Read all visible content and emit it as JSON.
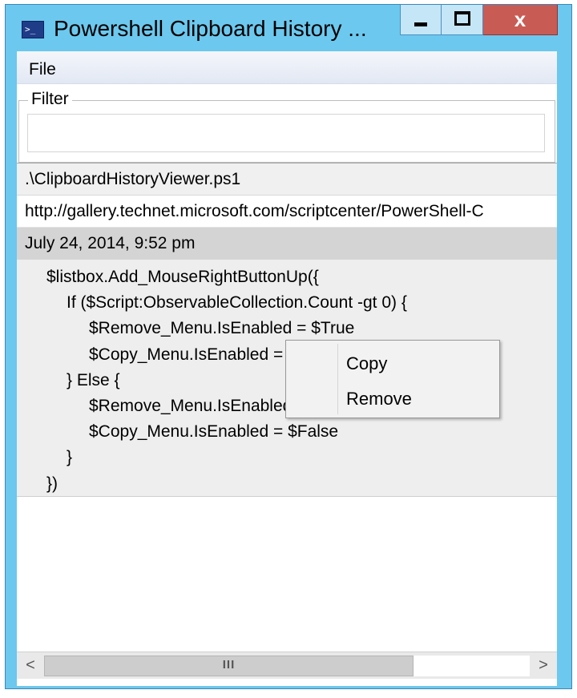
{
  "window": {
    "title": "Powershell Clipboard History ...",
    "icon": "powershell-icon",
    "controls": {
      "minimize": "minimize-icon",
      "maximize": "maximize-icon",
      "close_glyph": "x"
    }
  },
  "menubar": {
    "items": [
      {
        "label": "File"
      }
    ]
  },
  "filter": {
    "legend": "Filter",
    "value": "",
    "placeholder": ""
  },
  "history": {
    "items": [
      {
        "text": ".\\ClipboardHistoryViewer.ps1"
      },
      {
        "text": "http://gallery.technet.microsoft.com/scriptcenter/PowerShell-C"
      },
      {
        "text": "July 24, 2014, 9:52 pm"
      }
    ],
    "selected_code": [
      "$listbox.Add_MouseRightButtonUp({",
      "If ($Script:ObservableCollection.Count -gt 0) {",
      "$Remove_Menu.IsEnabled = $True",
      "$Copy_Menu.IsEnabled = $True",
      "} Else {",
      "$Remove_Menu.IsEnabled = $False",
      "$Copy_Menu.IsEnabled = $False",
      "}",
      "})"
    ]
  },
  "context_menu": {
    "items": [
      {
        "label": "Copy"
      },
      {
        "label": "Remove"
      }
    ]
  },
  "scrollbar": {
    "left_arrow": "<",
    "right_arrow": ">",
    "grip": "III",
    "thumb_fraction": 0.76
  },
  "colors": {
    "titlebar": "#6cc8ee",
    "close": "#c95b55",
    "selected_row": "#d4d4d4"
  }
}
